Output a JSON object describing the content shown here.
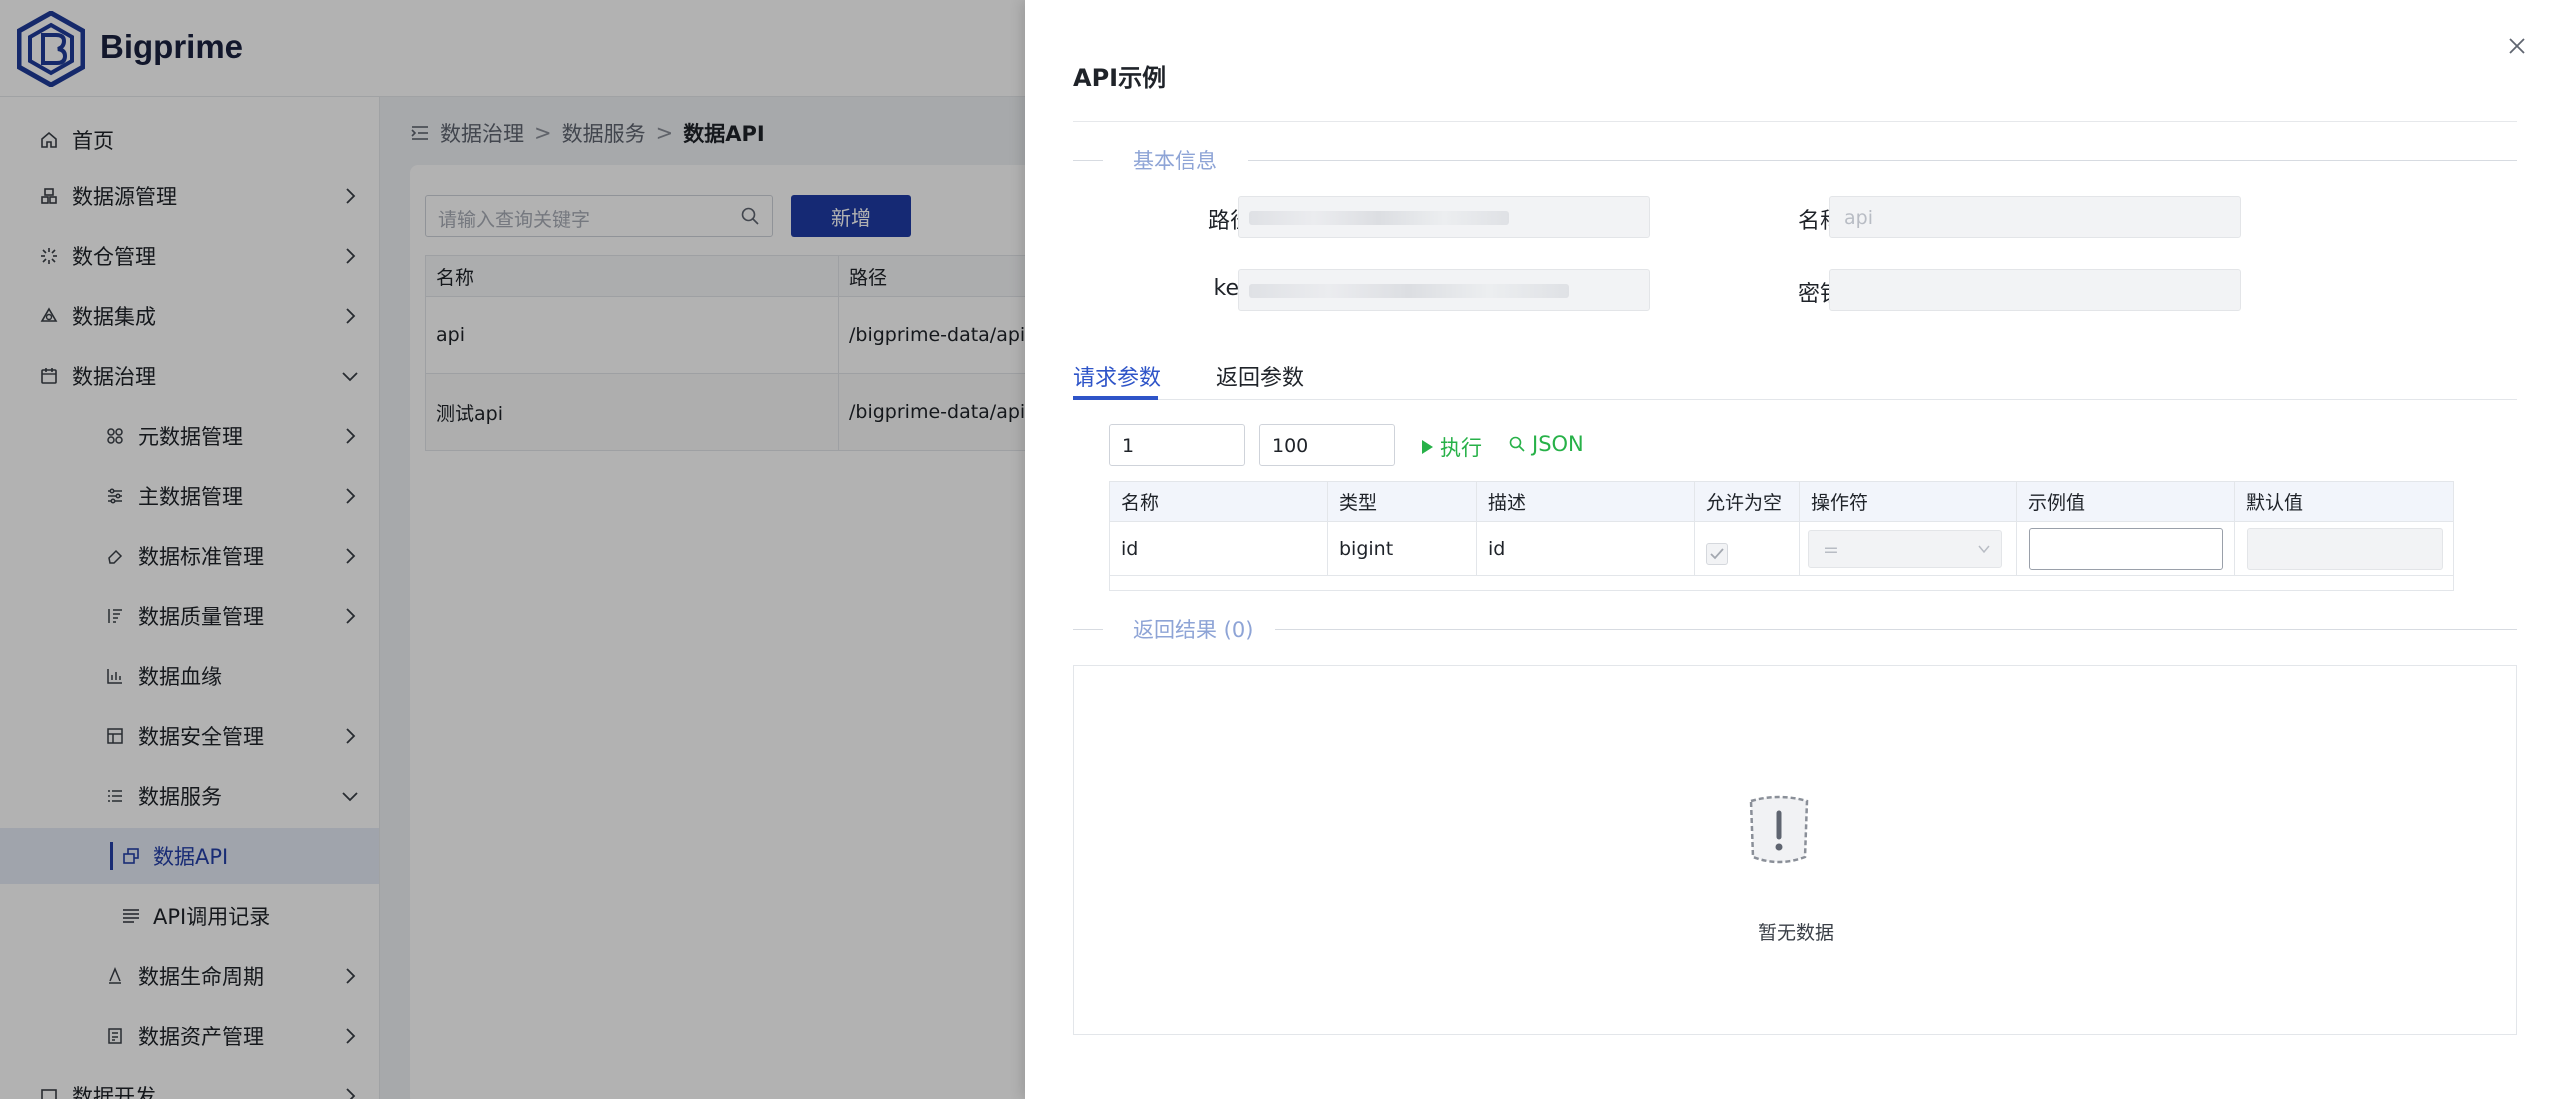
{
  "app": {
    "brand": "Bigprime"
  },
  "sidebar": {
    "items": [
      {
        "label": "首页",
        "icon": "home-icon",
        "has_arrow": false
      },
      {
        "label": "数据源管理",
        "icon": "database-icon",
        "has_arrow": true
      },
      {
        "label": "数仓管理",
        "icon": "warehouse-icon",
        "has_arrow": true
      },
      {
        "label": "数据集成",
        "icon": "integration-icon",
        "has_arrow": true
      },
      {
        "label": "数据治理",
        "icon": "governance-icon",
        "has_arrow": true,
        "expanded": true
      },
      {
        "label": "元数据管理",
        "icon": "metadata-icon",
        "has_arrow": true
      },
      {
        "label": "主数据管理",
        "icon": "master-data-icon",
        "has_arrow": true
      },
      {
        "label": "数据标准管理",
        "icon": "eraser-icon",
        "has_arrow": true
      },
      {
        "label": "数据质量管理",
        "icon": "quality-icon",
        "has_arrow": true
      },
      {
        "label": "数据血缘",
        "icon": "bar-chart-icon",
        "has_arrow": false
      },
      {
        "label": "数据安全管理",
        "icon": "table-icon",
        "has_arrow": true
      },
      {
        "label": "数据服务",
        "icon": "list-icon",
        "has_arrow": true,
        "expanded": true
      },
      {
        "label": "数据API",
        "icon": "api-window-icon",
        "has_arrow": false,
        "active": true
      },
      {
        "label": "API调用记录",
        "icon": "log-lines-icon",
        "has_arrow": false
      },
      {
        "label": "数据生命周期",
        "icon": "lifecycle-icon",
        "has_arrow": true
      },
      {
        "label": "数据资产管理",
        "icon": "asset-icon",
        "has_arrow": true
      },
      {
        "label": "数据开发",
        "icon": "dev-icon",
        "has_arrow": true
      }
    ]
  },
  "breadcrumb": {
    "items": [
      "数据治理",
      "数据服务",
      "数据API"
    ]
  },
  "list_page": {
    "search_placeholder": "请输入查询关键字",
    "add_button": "新增",
    "columns": [
      "名称",
      "路径"
    ],
    "rows": [
      {
        "name": "api",
        "path": "/bigprime-data/api/dat"
      },
      {
        "name": "测试api",
        "path": "/bigprime-data/api/dat"
      }
    ]
  },
  "drawer": {
    "title": "API示例",
    "basic_section": "基本信息",
    "fields": {
      "path_label": "路径",
      "name_label": "名称",
      "name_value": "api",
      "key_label": "key",
      "secret_label": "密钥"
    },
    "tabs": [
      "请求参数",
      "返回参数"
    ],
    "page_num": "1",
    "page_size": "100",
    "run_label": "执行",
    "json_label": "JSON",
    "params_columns": [
      "名称",
      "类型",
      "描述",
      "允许为空",
      "操作符",
      "示例值",
      "默认值"
    ],
    "params_rows": [
      {
        "name": "id",
        "type": "bigint",
        "desc": "id",
        "operator": "="
      }
    ],
    "result_section": "返回结果 (0)",
    "empty_text": "暂无数据",
    "colors": {
      "primary": "#2e54c8",
      "run_green": "#27b148",
      "section_blue": "#8ea4d6"
    }
  }
}
